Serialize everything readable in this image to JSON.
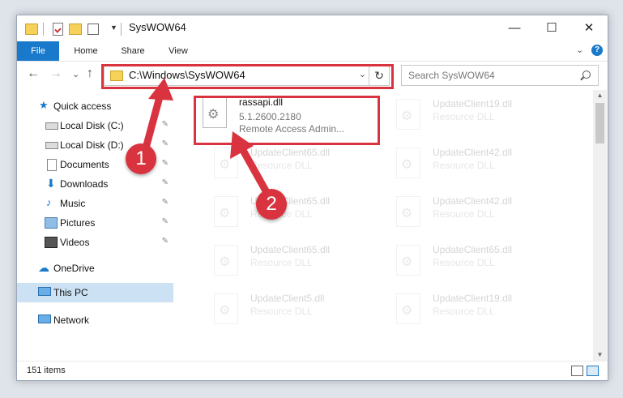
{
  "window": {
    "title": "SysWOW64",
    "minimize": "—",
    "maximize": "☐",
    "close": "✕"
  },
  "ribbon": {
    "tabs": [
      "File",
      "Home",
      "Share",
      "View"
    ],
    "expand": "⌄",
    "help": "?"
  },
  "nav": {
    "back": "←",
    "forward": "→",
    "recent": "⌄",
    "up": "↑",
    "address": "C:\\Windows\\SysWOW64",
    "address_dropdown": "⌄",
    "refresh": "↻",
    "search_placeholder": "Search SysWOW64"
  },
  "sidebar": {
    "items": [
      {
        "label": "Quick access",
        "icon": "star-icon"
      },
      {
        "label": "Local Disk (C:)",
        "icon": "disk-icon",
        "pinned": true
      },
      {
        "label": "Local Disk (D:)",
        "icon": "disk-icon",
        "pinned": true
      },
      {
        "label": "Documents",
        "icon": "documents-icon",
        "pinned": true
      },
      {
        "label": "Downloads",
        "icon": "download-icon",
        "pinned": true
      },
      {
        "label": "Music",
        "icon": "music-icon",
        "pinned": true
      },
      {
        "label": "Pictures",
        "icon": "pictures-icon",
        "pinned": true
      },
      {
        "label": "Videos",
        "icon": "videos-icon",
        "pinned": true
      },
      {
        "label": "OneDrive",
        "icon": "onedrive-icon"
      },
      {
        "label": "This PC",
        "icon": "pc-icon",
        "selected": true
      },
      {
        "label": "Network",
        "icon": "network-icon"
      }
    ],
    "pin_glyph": "📌"
  },
  "files": {
    "highlighted": {
      "name": "rassapi.dll",
      "version": "5.1.2600.2180",
      "description": "Remote Access Admin..."
    },
    "faded": [
      {
        "name": "UpdateClient19.dll",
        "description": "Resource DLL"
      },
      {
        "name": "UpdateClient65.dll",
        "description": "Resource DLL"
      },
      {
        "name": "UpdateClient42.dll",
        "description": "Resource DLL"
      },
      {
        "name": "UpdateClient65.dll",
        "description": "Resource DLL"
      },
      {
        "name": "UpdateClient42.dll",
        "description": "Resource DLL"
      },
      {
        "name": "UpdateClient65.dll",
        "description": "Resource DLL"
      },
      {
        "name": "UpdateClient65.dll",
        "description": "Resource DLL"
      },
      {
        "name": "UpdateClient5.dll",
        "description": "Resource DLL"
      },
      {
        "name": "UpdateClient19.dll",
        "description": "Resource DLL"
      }
    ]
  },
  "status": {
    "item_count": "151 items"
  },
  "annotations": {
    "step1": "1",
    "step2": "2",
    "color": "#d9333f"
  }
}
